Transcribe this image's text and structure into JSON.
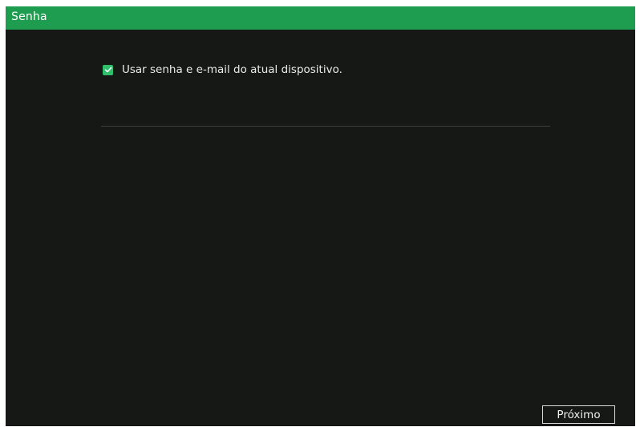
{
  "window": {
    "title": "Senha"
  },
  "options": {
    "use_device_password": {
      "label": "Usar senha e e-mail do atual dispositivo.",
      "checked": true
    }
  },
  "footer": {
    "next_label": "Próximo"
  },
  "colors": {
    "titlebar": "#1e9c50",
    "background": "#151815",
    "checkbox": "#2fbf6a",
    "separator": "#3d423d",
    "text": "#eaeaea"
  },
  "icons": {
    "checkbox_check": "checkmark-icon"
  }
}
